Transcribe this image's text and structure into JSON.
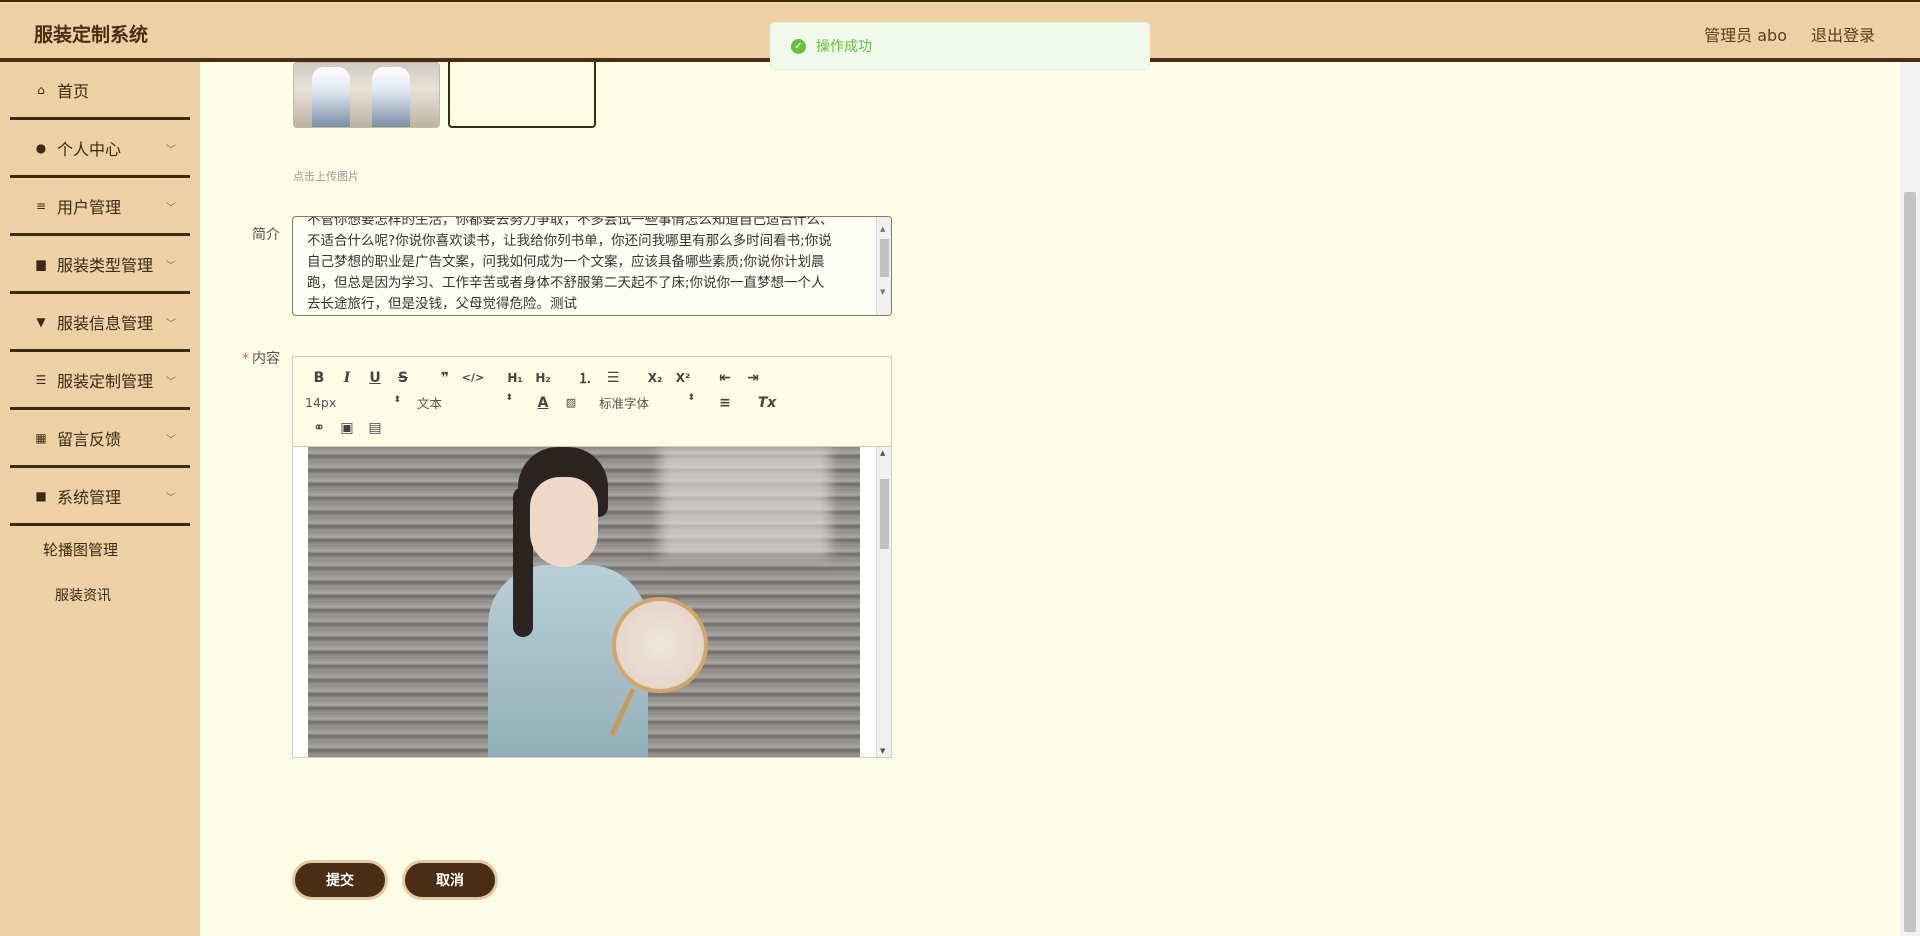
{
  "header": {
    "brand": "服装定制系统",
    "user": "管理员 abo",
    "logout": "退出登录"
  },
  "toast": {
    "message": "操作成功"
  },
  "sidebar": {
    "items": [
      {
        "label": "首页",
        "icon": "home-icon"
      },
      {
        "label": "个人中心",
        "icon": "user-icon"
      },
      {
        "label": "用户管理",
        "icon": "sliders-icon"
      },
      {
        "label": "服装类型管理",
        "icon": "briefcase-icon"
      },
      {
        "label": "服装信息管理",
        "icon": "brush-icon"
      },
      {
        "label": "服装定制管理",
        "icon": "list-icon"
      },
      {
        "label": "留言反馈",
        "icon": "grid-icon"
      },
      {
        "label": "系统管理",
        "icon": "apps-icon"
      }
    ],
    "subitems": [
      "轮播图管理",
      "服装资讯"
    ]
  },
  "form": {
    "upload_hint": "点击上传图片",
    "intro_label": "简介",
    "intro_lines": [
      "不管你想要怎样的生活，你都要去努力争取，不多尝试一些事情怎么知道自己适合什么、",
      "不适合什么呢?你说你喜欢读书，让我给你列书单，你还问我哪里有那么多时间看书;你说",
      "自己梦想的职业是广告文案，问我如何成为一个文案，应该具备哪些素质;你说你计划晨",
      "跑，但总是因为学习、工作辛苦或者身体不舒服第二天起不了床;你说你一直梦想一个人",
      "去长途旅行，但是没钱，父母觉得危险。测试"
    ],
    "content_label": "内容",
    "editor": {
      "font_size": "14px",
      "block_type": "文本",
      "font_family": "标准字体"
    },
    "submit": "提交",
    "cancel": "取消"
  },
  "colors": {
    "primary": "#4b2c14",
    "sidebar_bg": "#edd0a3",
    "page_bg": "#fefde6",
    "success": "#67c23a"
  }
}
